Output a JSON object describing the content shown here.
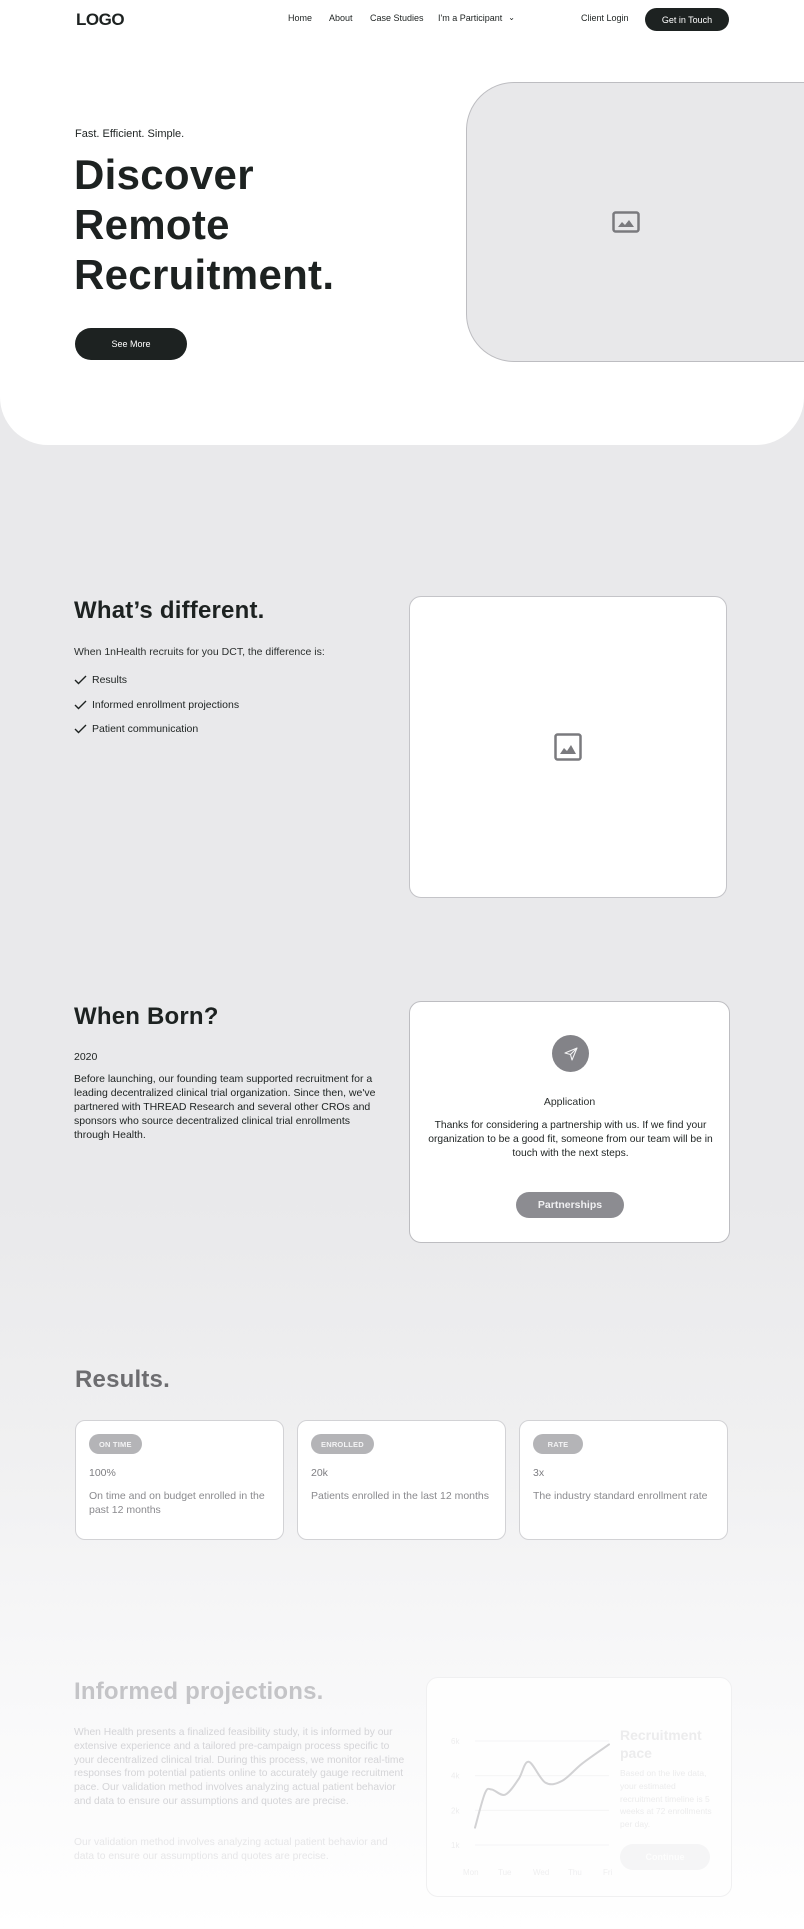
{
  "header": {
    "logo": "LOGO",
    "nav": [
      {
        "label": "Home"
      },
      {
        "label": "About"
      },
      {
        "label": "Case Studies"
      },
      {
        "label": "I'm a Participant",
        "has_dropdown": true
      }
    ],
    "client_login": "Client Login",
    "cta": "Get in Touch"
  },
  "hero": {
    "tagline": "Fast. Efficient. Simple.",
    "title_lines": [
      "Discover",
      "Remote",
      "Recruitment."
    ],
    "button": "See More",
    "image_icon": "image-placeholder-icon"
  },
  "whats_different": {
    "title": "What’s different.",
    "intro": "When 1nHealth recruits for you DCT, the difference is:",
    "items": [
      "Results",
      "Informed enrollment projections",
      "Patient communication"
    ],
    "item_icon": "check-icon",
    "image_icon": "image-placeholder-icon"
  },
  "when_born": {
    "title": "When Born?",
    "year": "2020",
    "body": "Before launching, our founding team supported recruitment for a leading decentralized clinical trial organization. Since then, we've partnered with THREAD Research and several other CROs and sponsors who source decentralized clinical trial enrollments through Health.",
    "card": {
      "icon": "paper-plane-icon",
      "title": "Application",
      "body": "Thanks for considering a partnership with us. If we find your organization to be a good fit, someone from our team will be in touch with the next steps.",
      "button": "Partnerships"
    }
  },
  "results": {
    "title": "Results.",
    "cards": [
      {
        "badge": "ON TIME",
        "value": "100%",
        "desc": "On time and on budget enrolled in the past 12 months"
      },
      {
        "badge": "ENROLLED",
        "value": "20k",
        "desc": "Patients enrolled in the last 12 months"
      },
      {
        "badge": "RATE",
        "value": "3x",
        "desc": "The industry standard enrollment rate"
      }
    ]
  },
  "informed_projections": {
    "title": "Informed projections.",
    "body": "When Health presents a finalized feasibility study, it is informed by our extensive experience and a tailored pre-campaign process specific to your decentralized clinical trial. During this process, we monitor real-time responses from potential patients online to accurately gauge recruitment pace. Our validation method involves analyzing actual patient behavior and data to ensure our assumptions and quotes are precise.",
    "body2": "Our validation method involves analyzing actual patient behavior and data to ensure our assumptions and quotes are precise.",
    "card": {
      "title": "Recruitment pace",
      "body": "Based on the live data, your estimated recruitment timeline is 5 weeks at 72 enrollments per day.",
      "button": "Continue"
    }
  },
  "chart_data": {
    "type": "line",
    "title": "Recruitment pace",
    "categories": [
      "Mon",
      "Tue",
      "Wed",
      "Thu",
      "Fri"
    ],
    "y_ticks": [
      "1k",
      "2k",
      "4k",
      "6k"
    ],
    "y_tick_values": [
      1000,
      2000,
      4000,
      6000
    ],
    "series": [
      {
        "name": "recruitment",
        "x": [
          0,
          0.3,
          0.5,
          0.9,
          1.3,
          1.6,
          2.1,
          2.6,
          3.2,
          4.0
        ],
        "values": [
          1500,
          3000,
          3200,
          2900,
          3800,
          4800,
          3600,
          3700,
          4700,
          5800
        ]
      }
    ],
    "ylim": [
      1000,
      6000
    ],
    "grid": true,
    "xlabel": "",
    "ylabel": ""
  }
}
